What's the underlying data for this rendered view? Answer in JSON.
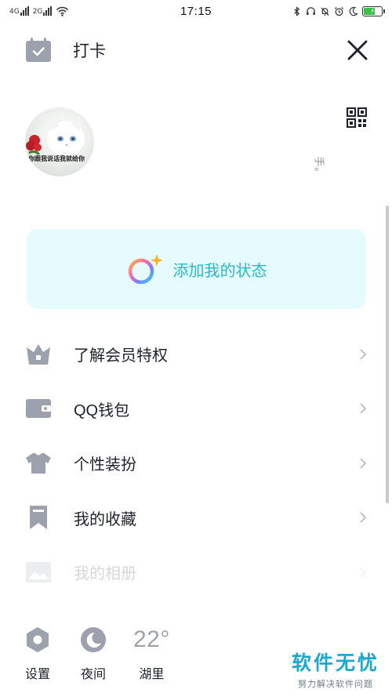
{
  "status_bar": {
    "time": "17:15",
    "network_1": "4G",
    "network_2": "2G"
  },
  "header": {
    "punch_label": "打卡",
    "close_icon": "close-icon"
  },
  "profile": {
    "avatar_caption": "你跟我说话我就给你",
    "signature": "手。",
    "qr_icon": "qr-code-icon"
  },
  "status_card": {
    "label": "添加我的状态",
    "icon": "status-ring-icon"
  },
  "menu": {
    "items": [
      {
        "label": "了解会员特权",
        "icon": "vip-basket-icon"
      },
      {
        "label": "QQ钱包",
        "icon": "wallet-icon"
      },
      {
        "label": "个性装扮",
        "icon": "shirt-icon"
      },
      {
        "label": "我的收藏",
        "icon": "bookmark-icon"
      },
      {
        "label": "我的相册",
        "icon": "album-icon"
      }
    ]
  },
  "bottom_bar": {
    "settings_label": "设置",
    "night_label": "夜间",
    "weather_temp": "22°",
    "weather_city": "湖里"
  },
  "watermark": {
    "title": "软件无忧",
    "subtitle": "努力解决软件问题"
  },
  "colors": {
    "icon_gray": "#9ca1ad",
    "card_bg": "#e5fbfe",
    "accent_teal": "#2fb6c6",
    "watermark_blue": "#1da7cf"
  }
}
